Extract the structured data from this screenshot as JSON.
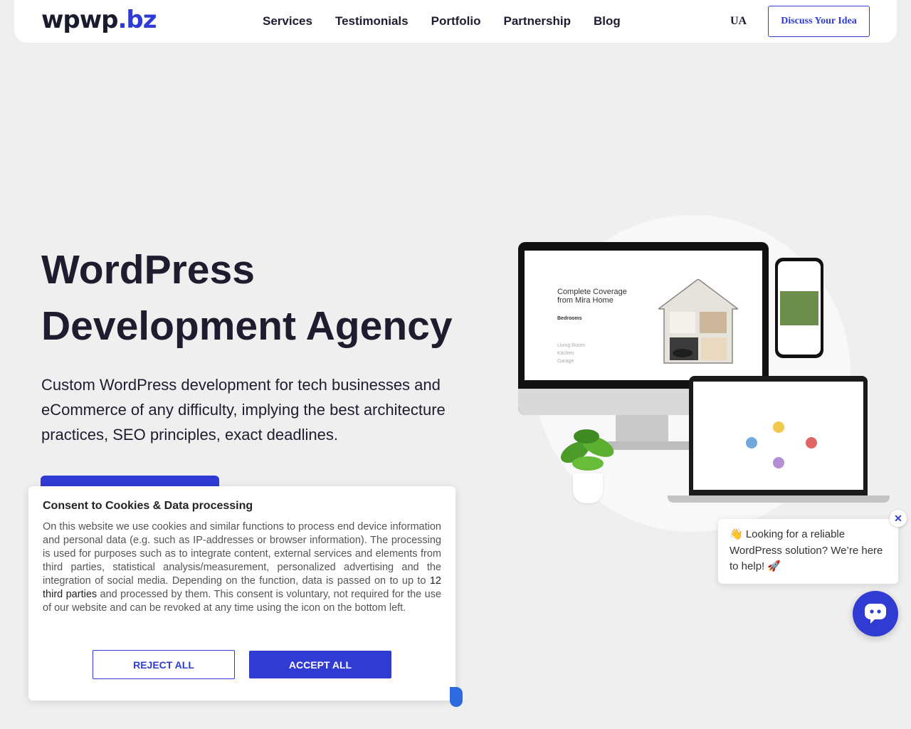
{
  "header": {
    "logo_part1": "wpwp",
    "logo_part2": ".bz",
    "nav": [
      "Services",
      "Testimonials",
      "Portfolio",
      "Partnership",
      "Blog"
    ],
    "lang": "UA",
    "cta": "Discuss Your Idea"
  },
  "hero": {
    "title_line1": "WordPress",
    "title_line2": "Development Agency",
    "description": "Custom WordPress development for tech businesses and eCommerce of any difficulty, implying the best architecture practices, SEO principles, exact deadlines."
  },
  "illustration": {
    "monitor_title": "Complete Coverage from Mira Home",
    "monitor_section": "Bedrooms",
    "monitor_list": [
      "Living Room",
      "Kitchen",
      "Garage"
    ]
  },
  "cookie": {
    "title": "Consent to Cookies & Data processing",
    "body_before": "On this website we use cookies and similar functions to process end device information and personal data (e.g. such as IP-addresses or browser information). The processing is used for purposes such as to integrate content, external services and elements from third parties, statistical analysis/measurement, personalized advertising and the integration of social media. Depending on the function, data is passed on to up to ",
    "body_link": "12 third parties",
    "body_after": " and processed by them. This consent is voluntary, not required for the use of our website and can be revoked at any time using the icon on the bottom left.",
    "reject": "REJECT ALL",
    "accept": "ACCEPT ALL"
  },
  "chat": {
    "message": "👋 Looking for a reliable WordPress solution? We’re here to help! 🚀",
    "close_icon": "✕"
  },
  "colors": {
    "accent": "#2f3bd2",
    "background": "#efefef"
  }
}
